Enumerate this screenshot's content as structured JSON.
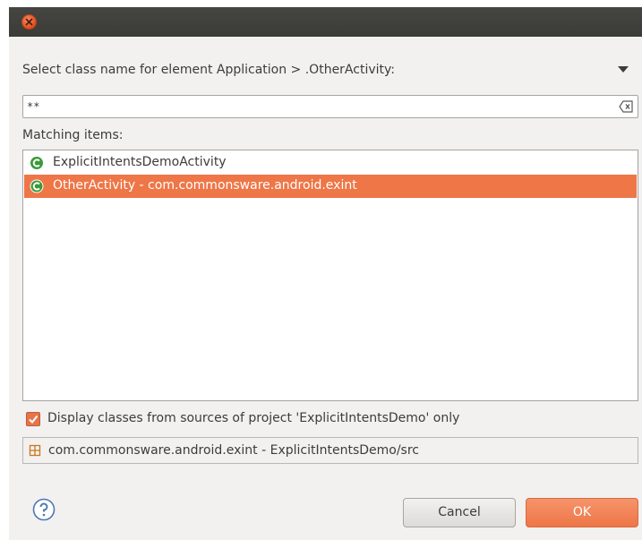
{
  "window": {
    "close_icon": "close-icon"
  },
  "dialog": {
    "prompt": "Select class name for element Application > .OtherActivity:",
    "menu_icon": "triangle-down-icon",
    "filter": {
      "value": "**",
      "clear_icon": "clear-text-icon"
    },
    "matching_label": "Matching items:",
    "items": [
      {
        "label": "ExplicitIntentsDemoActivity",
        "icon": "class-icon",
        "selected": false
      },
      {
        "label": "OtherActivity - com.commonsware.android.exint",
        "icon": "class-icon",
        "selected": true
      }
    ],
    "checkbox": {
      "label": "Display classes from sources of project 'ExplicitIntentsDemo' only",
      "checked": true
    },
    "status": {
      "text": "com.commonsware.android.exint - ExplicitIntentsDemo/src",
      "icon": "package-icon"
    },
    "help_icon": "help-icon",
    "buttons": {
      "cancel": "Cancel",
      "ok": "OK"
    }
  },
  "colors": {
    "accent": "#ee7647",
    "titlebar": "#3e3e3a",
    "dialog_bg": "#f2f1f0",
    "class_icon": "#3a9a3a"
  }
}
